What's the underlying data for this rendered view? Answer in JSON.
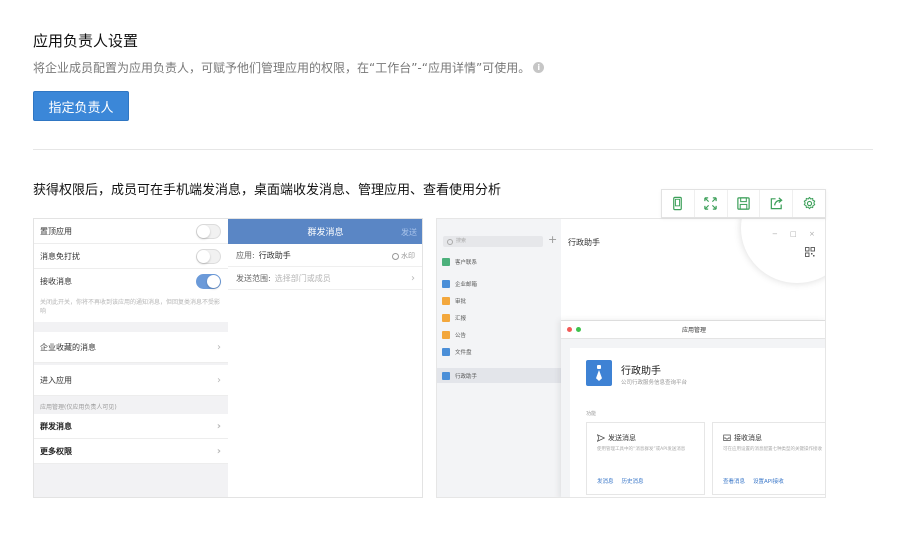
{
  "header": {
    "title": "应用负责人设置",
    "description": "将企业成员配置为应用负责人，可赋予他们管理应用的权限，在“工作台”-“应用详情”可使用。",
    "info_icon": "i",
    "assign_button": "指定负责人"
  },
  "section": {
    "heading": "获得权限后，成员可在手机端发消息，桌面端收发消息、管理应用、查看使用分析"
  },
  "phone": {
    "settings": [
      {
        "label": "置顶应用",
        "toggle": false
      },
      {
        "label": "消息免打扰",
        "toggle": false
      },
      {
        "label": "接收消息",
        "toggle": true
      }
    ],
    "note": "关闭此开关，你将不再收到该应用的通知消息，但回复类消息不受影响",
    "links": [
      "企业收藏的消息",
      "进入应用"
    ],
    "admin_section_label": "应用管理(仅应用负责人可见)",
    "admin_items": [
      "群发消息",
      "更多权限"
    ],
    "compose": {
      "title": "群发消息",
      "send": "发送",
      "app_label": "应用:",
      "app_value": "行政助手",
      "watermark": "水印",
      "scope_label": "发送范围:",
      "scope_placeholder": "选择部门或成员"
    }
  },
  "toolbar": {
    "icons": [
      "phone-icon",
      "fullscreen-icon",
      "save-icon",
      "share-icon",
      "settings-icon"
    ]
  },
  "desktop": {
    "search_placeholder": "搜索",
    "plus": "+",
    "sidebar": [
      {
        "label": "客户联系",
        "color": "#4cb07b"
      },
      {
        "label": "企业邮箱",
        "color": "#4b8fd8"
      },
      {
        "label": "审批",
        "color": "#f3a73c"
      },
      {
        "label": "汇报",
        "color": "#f3a73c"
      },
      {
        "label": "公告",
        "color": "#f3a73c"
      },
      {
        "label": "文件盘",
        "color": "#4b8fd8"
      },
      {
        "label": "行政助手",
        "color": "#4b8fd8"
      }
    ],
    "main_title": "行政助手",
    "window_controls": [
      "−",
      "□",
      "×"
    ],
    "window": {
      "title": "应用管理",
      "app_name": "行政助手",
      "app_desc": "公司行政服务信息查询平台",
      "features_label": "功能",
      "cards": [
        {
          "title": "发送消息",
          "desc": "使用管理工具中的“消息群发”或API发送消息",
          "links": [
            "发消息",
            "历史消息"
          ]
        },
        {
          "title": "接收消息",
          "desc": "可在应用设置的消息配置七种类型的关键操作接收",
          "links": [
            "查看消息",
            "设置API接收"
          ]
        }
      ]
    }
  }
}
